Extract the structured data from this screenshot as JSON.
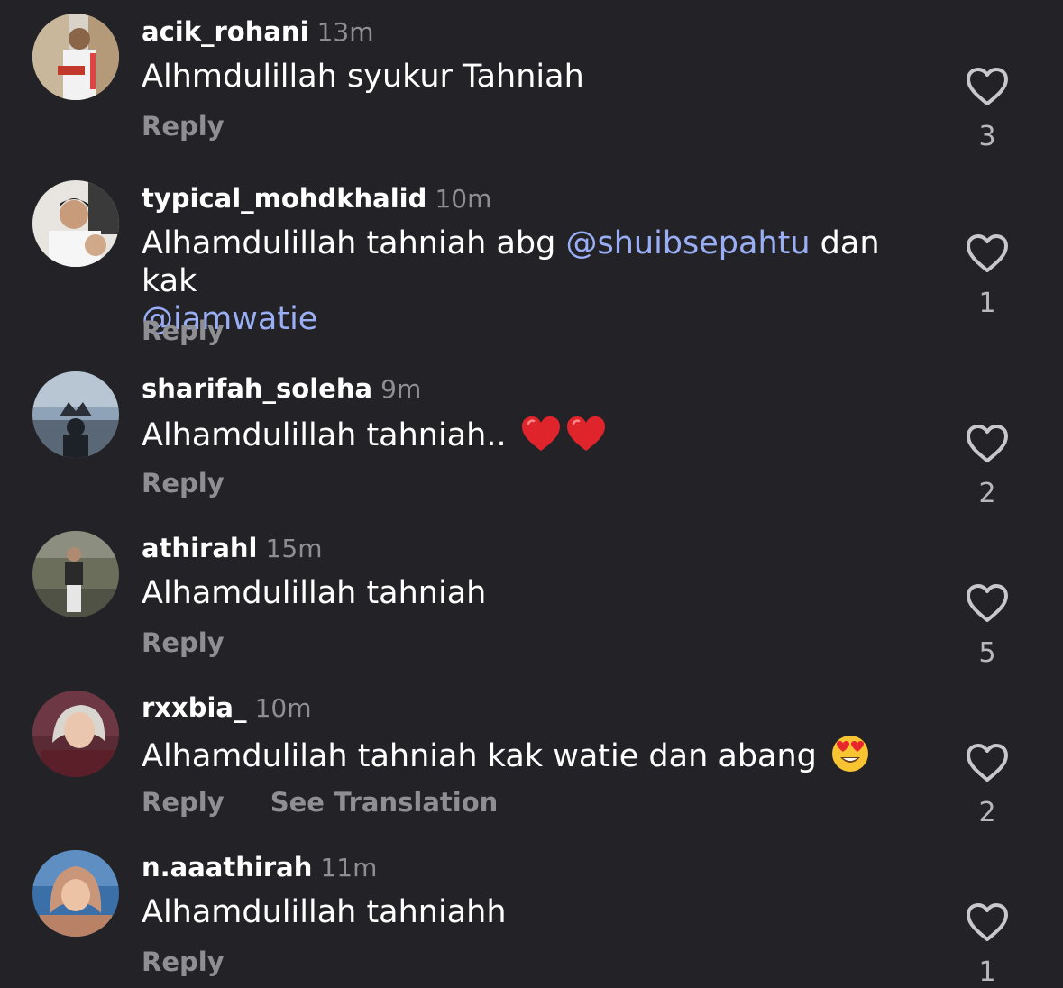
{
  "comments": [
    {
      "username": "acik_rohani",
      "time": "13m",
      "text": "Alhmdulillah syukur Tahniah",
      "reply": "Reply",
      "likes": "3"
    },
    {
      "username": "typical_mohdkhalid",
      "time": "10m",
      "text_before": "Alhamdulillah tahniah abg ",
      "mention1": "@shuibsepahtu",
      "text_middle": " dan kak",
      "mention2": "@iamwatie",
      "reply": "Reply",
      "likes": "1"
    },
    {
      "username": "sharifah_soleha",
      "time": "9m",
      "text": "Alhamdulillah tahniah..",
      "emojis": [
        "red-heart",
        "red-heart"
      ],
      "reply": "Reply",
      "likes": "2"
    },
    {
      "username": "athirahl",
      "time": "15m",
      "text": "Alhamdulillah tahniah",
      "reply": "Reply",
      "likes": "5"
    },
    {
      "username": "rxxbia_",
      "time": "10m",
      "text": "Alhamdulilah tahniah kak watie dan abang",
      "emojis": [
        "heart-eyes-face"
      ],
      "reply": "Reply",
      "see_translation": "See Translation",
      "likes": "2"
    },
    {
      "username": "n.aaathirah",
      "time": "11m",
      "text": "Alhamdulillah tahniahh",
      "reply": "Reply",
      "likes": "1"
    }
  ],
  "icons": {
    "like": "heart-outline-icon"
  },
  "colors": {
    "background": "#232327",
    "mention": "#9aaef6",
    "secondary_text": "#8e8e93",
    "like_count": "#b7b7bc"
  }
}
